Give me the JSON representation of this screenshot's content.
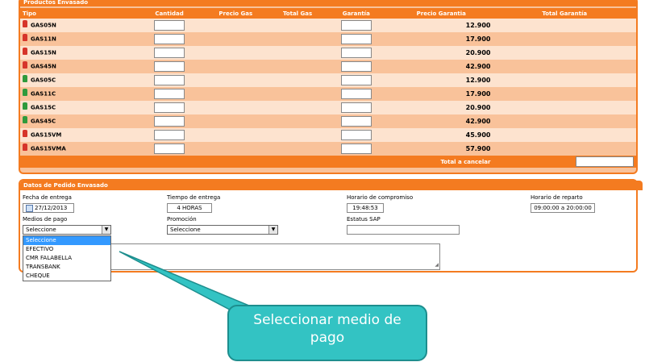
{
  "products": {
    "title": "Productos Envasado",
    "headers": {
      "tipo": "Tipo",
      "cantidad": "Cantidad",
      "precio_gas": "Precio Gas",
      "total_gas": "Total Gas",
      "garantia": "Garantía",
      "precio_garantia": "Precio Garantia",
      "total_garantia": "Total Garantía"
    },
    "rows": [
      {
        "code": "GAS05N",
        "price": "12.900",
        "color": "red"
      },
      {
        "code": "GAS11N",
        "price": "17.900",
        "color": "red"
      },
      {
        "code": "GAS15N",
        "price": "20.900",
        "color": "red"
      },
      {
        "code": "GAS45N",
        "price": "42.900",
        "color": "red"
      },
      {
        "code": "GAS05C",
        "price": "12.900",
        "color": "green"
      },
      {
        "code": "GAS11C",
        "price": "17.900",
        "color": "green"
      },
      {
        "code": "GAS15C",
        "price": "20.900",
        "color": "green"
      },
      {
        "code": "GAS45C",
        "price": "42.900",
        "color": "green"
      },
      {
        "code": "GAS15VM",
        "price": "45.900",
        "color": "red"
      },
      {
        "code": "GAS15VMA",
        "price": "57.900",
        "color": "red"
      }
    ],
    "total_label": "Total a cancelar"
  },
  "order": {
    "title": "Datos de Pedido Envasado",
    "fecha_label": "Fecha de entrega",
    "fecha_value": "27/12/2013",
    "tiempo_label": "Tiempo de entrega",
    "tiempo_value": "4 HORAS",
    "horario_comp_label": "Horario de compromiso",
    "horario_comp_value": "19:48:53",
    "horario_rep_label": "Horario de reparto",
    "horario_rep_value": "09:00:00 a 20:00:00",
    "medios_label": "Medios de pago",
    "medios_value": "Seleccione",
    "medios_options": [
      "Seleccione",
      "EFECTIVO",
      "CMR FALABELLA",
      "TRANSBANK",
      "CHEQUE"
    ],
    "promocion_label": "Promoción",
    "promocion_value": "Seleccione",
    "estatus_label": "Estatus SAP"
  },
  "callout": {
    "text": "Seleccionar medio de pago"
  },
  "colors": {
    "accent": "#f47b20",
    "row_light": "#fde3cf",
    "row_dark": "#f9c29a",
    "callout": "#33c3c3",
    "selected": "#3399ff"
  }
}
